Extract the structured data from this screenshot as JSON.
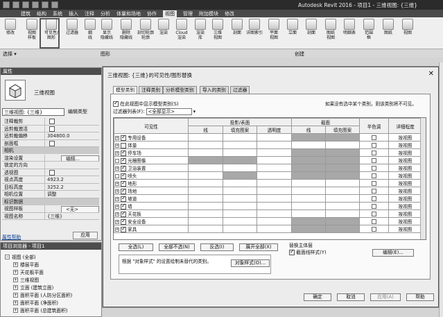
{
  "app": {
    "title": "Autodesk Revit 2016 - 项目1 - 三维视图: {三维}"
  },
  "menu": [
    "建筑",
    "结构",
    "系统",
    "插入",
    "注释",
    "分析",
    "体量和场地",
    "协作",
    "视图",
    "管理",
    "附加模块",
    "修改"
  ],
  "menu_active": "视图",
  "ribbon": {
    "tools": [
      "修改",
      "视图\n样板",
      "可见性/\n图形",
      "过滤器",
      "细\n线",
      "显示\n隐藏线",
      "删除\n隐藏线",
      "剖切轮廓\n轮廓",
      "渲染",
      "Cloud\n渲染",
      "渲染\n库",
      "三维\n视图",
      "剖面",
      "详图索引",
      "平面\n视图",
      "立面",
      "剖面",
      "图纸\n视图",
      "明细表",
      "范围\n框",
      "图纸",
      "视图"
    ],
    "panels": [
      "选择 ▾",
      "图形",
      "创建"
    ]
  },
  "properties": {
    "header": "属性",
    "type_name": "三维视图",
    "selector": "三维视图: {三维}",
    "edit_type": "编辑类型",
    "rows": [
      {
        "k": "注释裁剪",
        "cb": true
      },
      {
        "k": "远剪裁激活",
        "cb": true
      },
      {
        "k": "远剪裁偏移",
        "v": "304800.0"
      },
      {
        "k": "剖面框",
        "cb": true
      },
      {
        "section": "相机"
      },
      {
        "k": "渲染设置",
        "btn": "编辑..."
      },
      {
        "k": "锁定的方向",
        "v": ""
      },
      {
        "k": "透视图",
        "cb": true
      },
      {
        "k": "视点高度",
        "v": "4923.2"
      },
      {
        "k": "目标高度",
        "v": "3252.2"
      },
      {
        "k": "相机位置",
        "v": "调整"
      },
      {
        "section": "标识数据"
      },
      {
        "k": "视图样板",
        "btn": "<无>"
      },
      {
        "k": "视图名称",
        "v": "{三维}"
      }
    ],
    "help": "属性帮助",
    "apply": "应用"
  },
  "browser": {
    "header": "项目浏览器 - 项目1",
    "items": [
      "视图 (全部)",
      "楼层平面",
      "天花板平面",
      "三维视图",
      "立面 (建筑立面)",
      "面积平面 (人防分区面积)",
      "面积平面 (净面积)",
      "面积平面 (总建筑面积)"
    ]
  },
  "dialog": {
    "title": "三维视图: {三维}的可见性/图形替换",
    "tabs": [
      "模型类别",
      "注释类别",
      "分析模型类别",
      "导入的类别",
      "过滤器"
    ],
    "show_cats": "在此视图中显示模型类别(S)",
    "note": "如果没有选中某个类别，则该类别将不可见。",
    "filter_label": "过滤器列表(F):",
    "filter_value": "<全部显示>",
    "headers": {
      "visibility": "可见性",
      "proj": "投影/表面",
      "line": "线",
      "fill": "填充图案",
      "trans": "透明度",
      "cut": "截面",
      "cut_line": "线",
      "cut_fill": "填充图案",
      "halftone": "半色调",
      "detail": "详细程度"
    },
    "rows": [
      {
        "name": "专用设备",
        "exp": true,
        "on": true,
        "gray": [
          false,
          false,
          false,
          true,
          true
        ],
        "detail": "按视图"
      },
      {
        "name": "体量",
        "exp": true,
        "on": false,
        "gray": [
          false,
          false,
          false,
          false,
          false
        ],
        "detail": "按视图"
      },
      {
        "name": "停车场",
        "exp": true,
        "on": true,
        "gray": [
          false,
          false,
          false,
          true,
          true
        ],
        "detail": "按视图"
      },
      {
        "name": "光栅图像",
        "exp": false,
        "on": true,
        "gray": [
          true,
          true,
          false,
          true,
          true
        ],
        "detail": "按视图"
      },
      {
        "name": "卫浴装置",
        "exp": true,
        "on": true,
        "gray": [
          false,
          false,
          false,
          true,
          true
        ],
        "detail": "按视图"
      },
      {
        "name": "喷头",
        "exp": false,
        "on": true,
        "gray": [
          false,
          true,
          false,
          true,
          true
        ],
        "detail": "按视图"
      },
      {
        "name": "地形",
        "exp": true,
        "on": true,
        "gray": [
          false,
          false,
          false,
          false,
          false
        ],
        "detail": "按视图"
      },
      {
        "name": "场地",
        "exp": true,
        "on": true,
        "gray": [
          false,
          false,
          false,
          false,
          false
        ],
        "detail": "按视图"
      },
      {
        "name": "坡道",
        "exp": true,
        "on": true,
        "gray": [
          false,
          false,
          false,
          false,
          false
        ],
        "detail": "按视图"
      },
      {
        "name": "墙",
        "exp": true,
        "on": true,
        "gray": [
          false,
          false,
          false,
          false,
          false
        ],
        "detail": "按视图"
      },
      {
        "name": "天花板",
        "exp": true,
        "on": true,
        "gray": [
          false,
          false,
          false,
          false,
          false
        ],
        "detail": "按视图"
      },
      {
        "name": "安全设备",
        "exp": true,
        "on": true,
        "gray": [
          false,
          false,
          false,
          true,
          true
        ],
        "detail": "按视图"
      },
      {
        "name": "家具",
        "exp": true,
        "on": true,
        "gray": [
          false,
          false,
          false,
          true,
          true
        ],
        "detail": "按视图"
      }
    ],
    "buttons": {
      "all": "全选(L)",
      "none": "全部不选(N)",
      "invert": "反选(I)",
      "expand": "展开全部(X)",
      "edit": "编辑(E)...",
      "obj_style": "对象样式(O)...",
      "ok": "确定",
      "cancel": "取消",
      "apply": "应用(A)",
      "help": "帮助"
    },
    "host_label": "替换主体层",
    "cut_line_style": "截面线样式(Y)",
    "override_note": "根据 \"对象样式\" 的设置绘制未替代的类别。"
  }
}
